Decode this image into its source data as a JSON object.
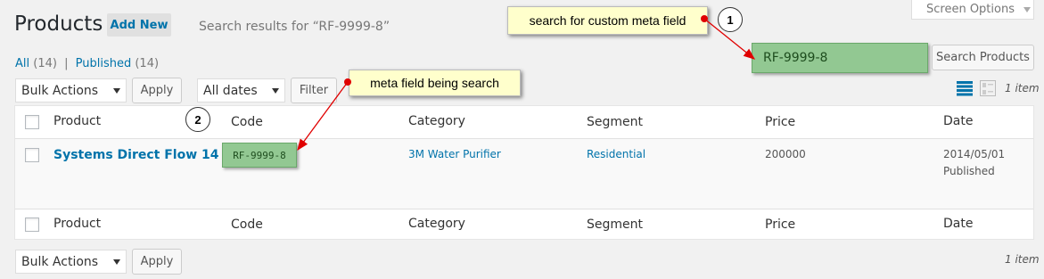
{
  "header": {
    "title": "Products",
    "add_new": "Add New",
    "search_results": "Search results for “RF-9999-8”",
    "screen_options": "Screen Options"
  },
  "filters": {
    "all_label": "All",
    "all_count": "(14)",
    "separator": "|",
    "published_label": "Published",
    "published_count": "(14)"
  },
  "search": {
    "value": "RF-9999-8",
    "button": "Search Products"
  },
  "tablenav_top": {
    "bulk_actions": "Bulk Actions",
    "apply": "Apply",
    "dates": "All dates",
    "filter": "Filter",
    "item_count": "1 item"
  },
  "tablenav_bottom": {
    "bulk_actions": "Bulk Actions",
    "apply": "Apply",
    "item_count": "1 item"
  },
  "table": {
    "columns": [
      "Product",
      "Code",
      "Category",
      "Segment",
      "Price",
      "Date"
    ],
    "rows": [
      {
        "product": "Systems Direct Flow 14",
        "code": "RF-9999-8",
        "category": "3M Water Purifier",
        "segment": "Residential",
        "price": "200000",
        "date": "2014/05/01",
        "status": "Published"
      }
    ]
  },
  "annotations": {
    "note1": "search for custom meta field",
    "note2": "meta field being search",
    "num1": "1",
    "num2": "2"
  },
  "colors": {
    "link": "#0073aa",
    "highlight_green": "#92c892",
    "note_yellow": "#ffffcc",
    "arrow_red": "#e00000"
  }
}
